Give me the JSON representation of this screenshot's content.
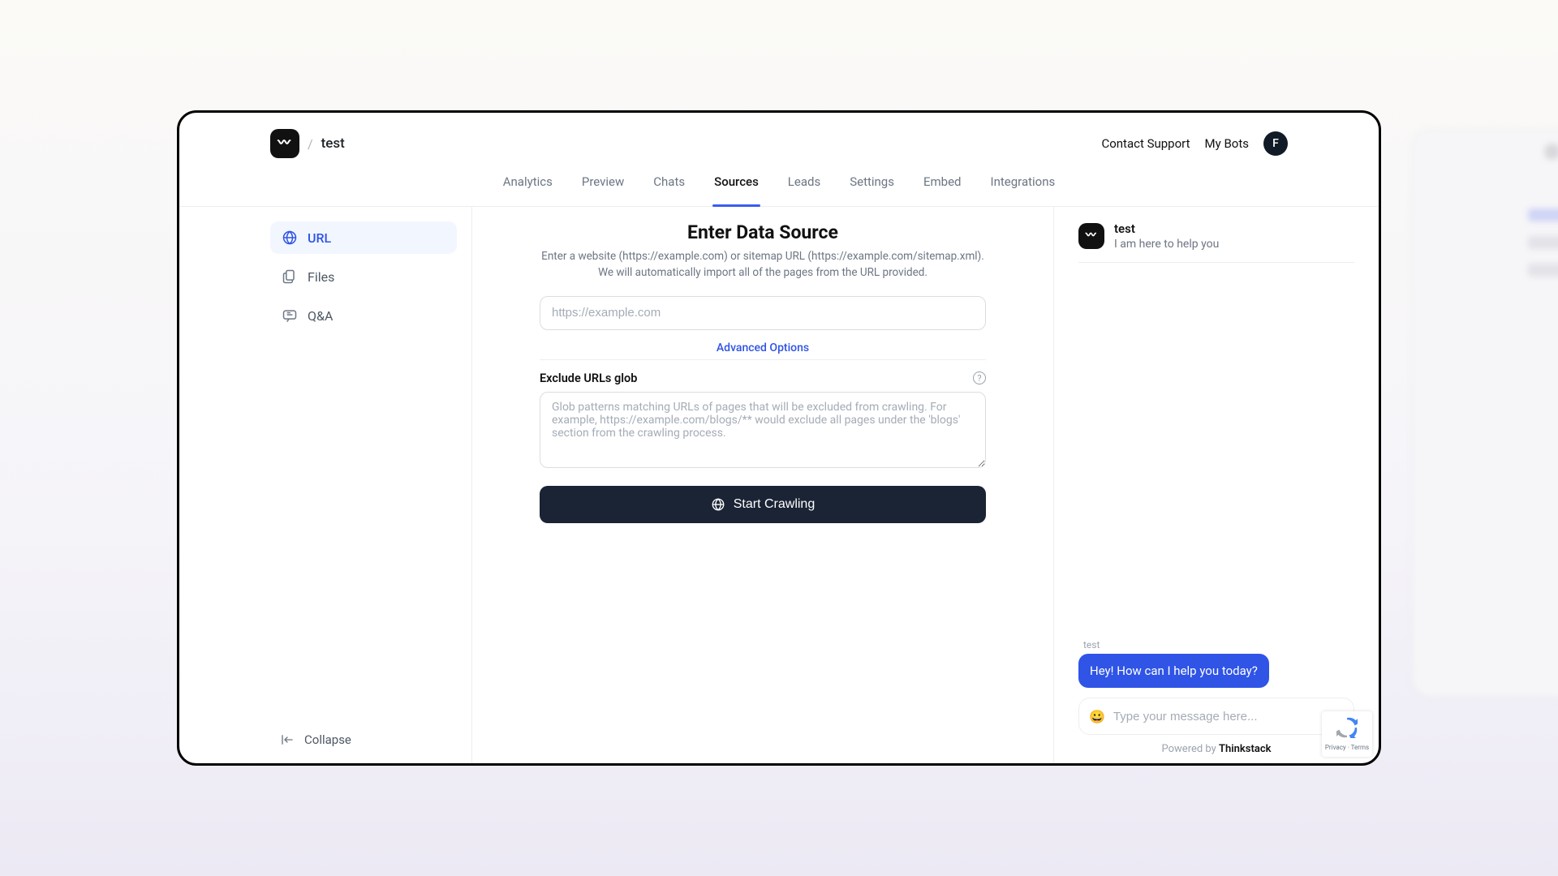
{
  "topbar": {
    "title": "test",
    "support": "Contact Support",
    "myBots": "My Bots",
    "avatar": "F"
  },
  "tabs": {
    "items": [
      "Analytics",
      "Preview",
      "Chats",
      "Sources",
      "Leads",
      "Settings",
      "Embed",
      "Integrations"
    ],
    "activeIndex": 3
  },
  "sidebar": {
    "items": [
      {
        "label": "URL",
        "icon": "globe"
      },
      {
        "label": "Files",
        "icon": "files"
      },
      {
        "label": "Q&A",
        "icon": "chat"
      }
    ],
    "activeIndex": 0,
    "collapse": "Collapse"
  },
  "main": {
    "heading": "Enter Data Source",
    "subtitle": "Enter a website (https://example.com) or sitemap URL (https://example.com/sitemap.xml). We will automatically import all of the pages from the URL provided.",
    "urlPlaceholder": "https://example.com",
    "advanced": "Advanced Options",
    "excludeLabel": "Exclude URLs glob",
    "excludePlaceholder": "Glob patterns matching URLs of pages that will be excluded from crawling. For example, https://example.com/blogs/** would exclude all pages under the 'blogs' section from the crawling process.",
    "crawlBtn": "Start Crawling"
  },
  "chat": {
    "name": "test",
    "tagline": "I am here to help you",
    "senderLabel": "test",
    "greeting": "Hey! How can I help you today?",
    "inputPlaceholder": "Type your message here...",
    "poweredPrefix": "Powered by ",
    "poweredBrand": "Thinkstack"
  },
  "recaptcha": {
    "line": "Privacy · Terms"
  }
}
